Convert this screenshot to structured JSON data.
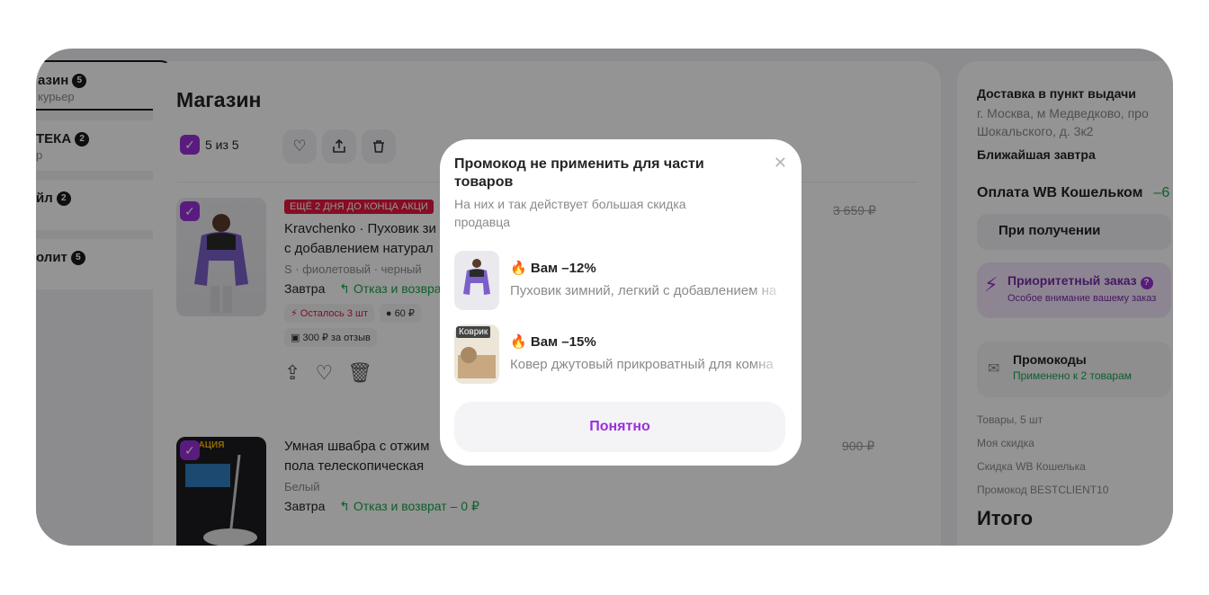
{
  "tabs": [
    {
      "title": "азин",
      "badge": "5",
      "sub": "курьер"
    },
    {
      "title": "ТЕКА",
      "badge": "2",
      "sub": "р"
    },
    {
      "title": "йл",
      "badge": "2",
      "sub": ""
    },
    {
      "title": "олит",
      "badge": "5",
      "sub": ""
    }
  ],
  "main": {
    "title": "Магазин",
    "select_all": "5 из 5",
    "toolbar_icons": [
      "heart-icon",
      "share-icon",
      "trash-icon"
    ],
    "items": [
      {
        "promo": "ЕЩЁ 2 ДНЯ ДО КОНЦА АКЦИ",
        "title_line1": "Kravchenko · Пуховик зи",
        "title_line2": "с добавлением натурал",
        "meta": "S · фиолетовый · черный",
        "delivery": "Завтра",
        "return": "Отказ и возвра",
        "chips": [
          "Осталось 3 шт",
          "60 ₽",
          "300 ₽ за отзыв"
        ],
        "old_price": "3 659 ₽"
      },
      {
        "promo": "",
        "thumb_label": "ОВАЦИЯ",
        "title_line1": "Умная швабра с отжим",
        "title_line2": "пола телескопическая",
        "meta": "Белый",
        "delivery": "Завтра",
        "return": "Отказ и возврат – 0 ₽",
        "chips": [],
        "old_price": "900 ₽"
      }
    ]
  },
  "side": {
    "delivery_title": "Доставка в пункт выдачи",
    "address_line1": "г. Москва, м Медведково, про",
    "address_line2": "Шокальского, д. 3к2",
    "nearest": "Ближайшая завтра",
    "pay_title": "Оплата WB Кошельком",
    "pay_discount": "–6",
    "pay_option": "При получении",
    "priority_title": "Приоритетный заказ",
    "priority_sub": "Особое внимание вашему заказ",
    "promo_title": "Промокоды",
    "promo_sub": "Применено к 2 товарам",
    "summary": [
      "Товары, 5 шт",
      "Моя скидка",
      "Скидка WB Кошелька",
      "Промокод BESTCLIENT10"
    ],
    "total": "Итого"
  },
  "modal": {
    "title": "Промокод не применить для части товаров",
    "subtitle": "На них и так действует большая скидка продавца",
    "items": [
      {
        "discount": "Вам –12%",
        "name": "Пуховик зимний, легкий с добавлением на",
        "thumb_label": ""
      },
      {
        "discount": "Вам –15%",
        "name": "Ковер джутовый прикроватный для комна",
        "thumb_label": "Коврик"
      }
    ],
    "button": "Понятно"
  },
  "colors": {
    "accent": "#9b2fd9",
    "green": "#1aa34a",
    "red": "#e5173f"
  }
}
